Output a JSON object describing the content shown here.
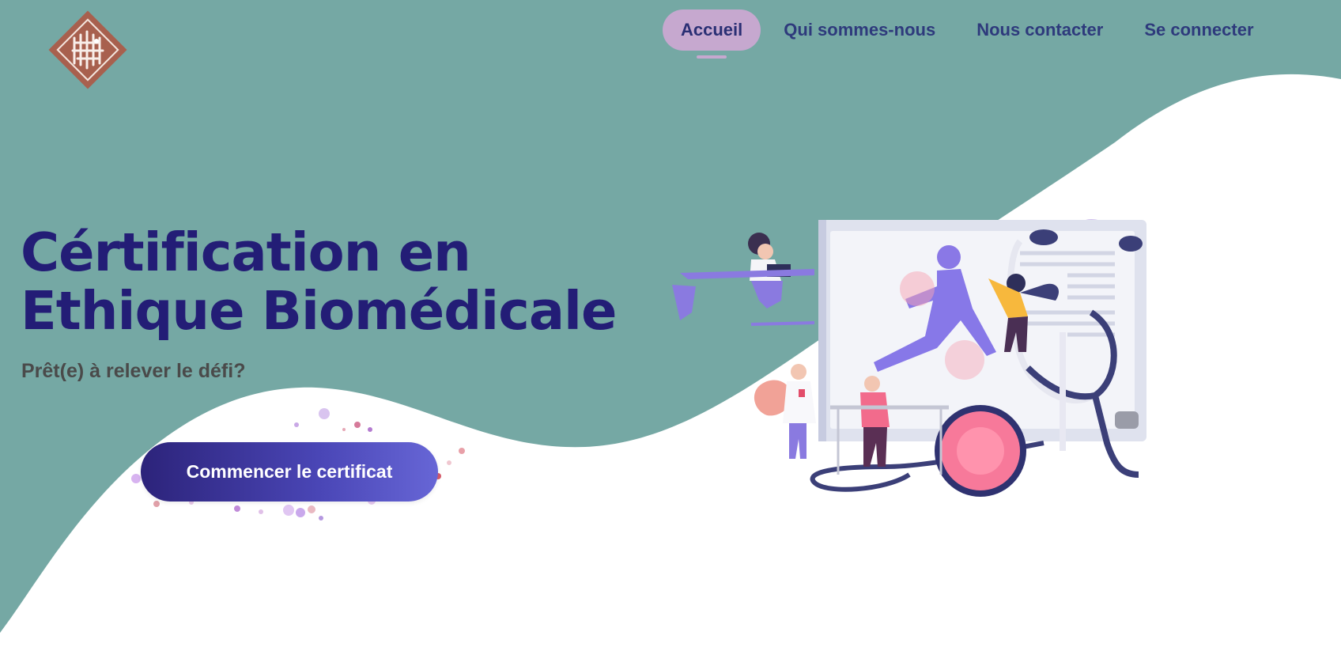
{
  "header": {
    "logo_icon": "university-seal-logo",
    "nav": [
      {
        "label": "Accueil",
        "active": true
      },
      {
        "label": "Qui sommes-nous",
        "active": false
      },
      {
        "label": "Nous contacter",
        "active": false
      },
      {
        "label": "Se connecter",
        "active": false
      }
    ]
  },
  "hero": {
    "title_line1": "Cértification en",
    "title_line2": "Ethique Biomédicale",
    "subtitle": "Prêt(e) à relever le défi?",
    "cta_label": "Commencer le certificat",
    "illustration_icon": "medical-monitor-illustration"
  },
  "colors": {
    "teal_background": "#75a8a4",
    "title": "#231d76",
    "nav_text": "#2e3a7c",
    "nav_active_bg": "#c6a8cf",
    "cta_start": "#2c237a",
    "cta_end": "#6766d6"
  }
}
